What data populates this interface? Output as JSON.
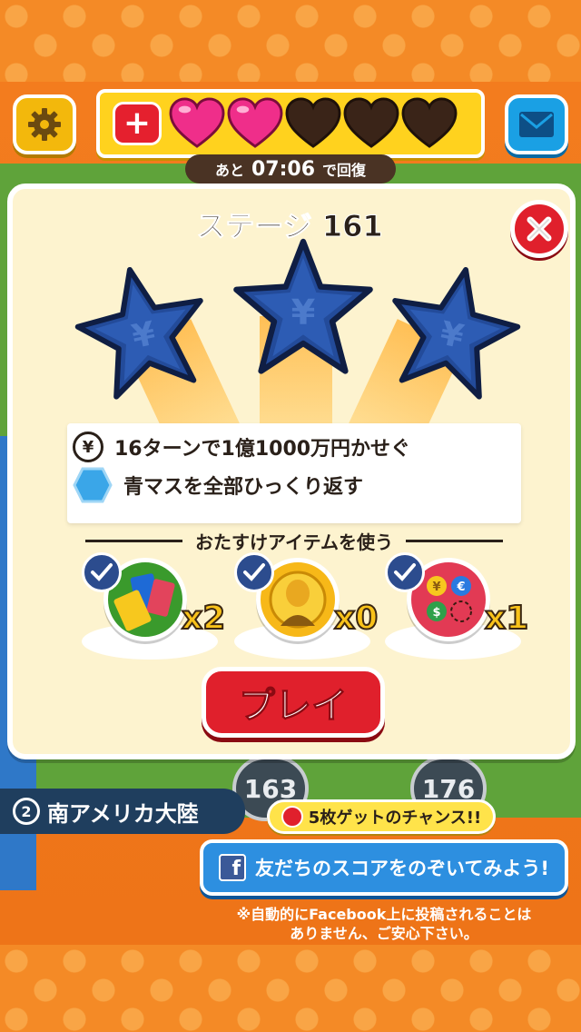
{
  "header": {
    "settings_icon": "gear-icon",
    "mail_icon": "envelope-icon",
    "lives": {
      "filled": 2,
      "empty": 3,
      "add_label": "+"
    },
    "timer": {
      "prefix": "あと",
      "time": "07:06",
      "suffix": "で回復"
    }
  },
  "dialog": {
    "stage_title": "ステージ 161",
    "close_icon": "close-icon",
    "stars": {
      "earned": 3,
      "total": 3
    },
    "objectives": [
      {
        "icon": "yen-coin-icon",
        "text": "16ターンで1億1000万円かせぐ"
      },
      {
        "icon": "blue-hexagon-icon",
        "text": "青マスを全部ひっくり返す"
      }
    ],
    "items_heading": "おたすけアイテムを使う",
    "items": [
      {
        "name": "cash-item",
        "count": "x2",
        "checked": true
      },
      {
        "name": "portrait-coin-item",
        "count": "x0",
        "checked": true
      },
      {
        "name": "currency-item",
        "count": "x1",
        "checked": true
      }
    ],
    "play_label": "プレイ"
  },
  "map": {
    "nodes": [
      "163",
      "176"
    ],
    "region_label": "南アメリカ大陸",
    "region_number": "2"
  },
  "promo": {
    "chance_text": "5枚ゲットのチャンス!!",
    "facebook_button": "友だちのスコアをのぞいてみよう!",
    "facebook_logo": "f",
    "notice_line1": "※自動的にFacebook上に投稿されることは",
    "notice_line2": "ありません、ご安心下さい。"
  },
  "colors": {
    "orange": "#f48a26",
    "red": "#e0202c",
    "yellow": "#ffd21e",
    "blue": "#2d8fe0",
    "star_blue": "#234b9a"
  }
}
